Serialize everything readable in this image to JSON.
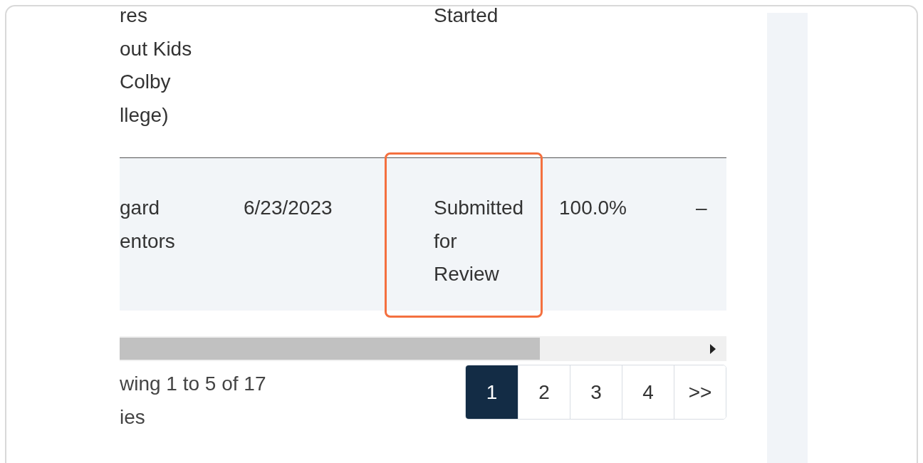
{
  "table": {
    "rows": [
      {
        "cells": [
          [
            "res",
            "out Kids",
            "Colby",
            "llege)"
          ],
          [],
          [
            "Started"
          ],
          [],
          []
        ],
        "highlighted": false
      },
      {
        "cells": [
          [
            "gard",
            "entors"
          ],
          [
            "6/23/2023"
          ],
          [
            "Submitted",
            "for",
            "Review"
          ],
          [
            "100.0%"
          ],
          [
            "–"
          ]
        ],
        "highlighted": true
      }
    ]
  },
  "footer": {
    "info": [
      "wing 1 to 5 of 17",
      "ies"
    ]
  },
  "pagination": [
    {
      "label": "1",
      "selected": true
    },
    {
      "label": "2",
      "selected": false
    },
    {
      "label": "3",
      "selected": false
    },
    {
      "label": "4",
      "selected": false
    },
    {
      "label": ">>",
      "selected": false
    }
  ]
}
